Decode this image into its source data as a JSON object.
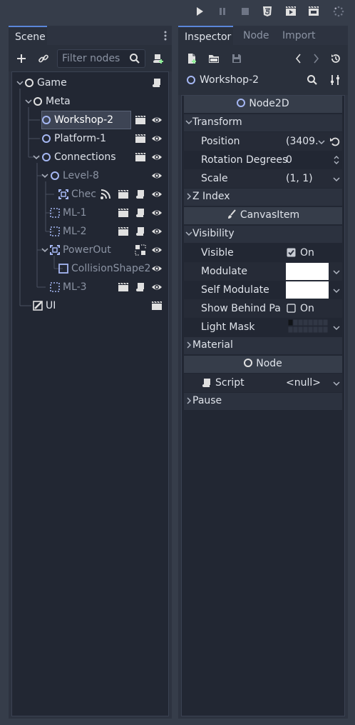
{
  "toolbar": {
    "play": "play-icon",
    "pause": "pause-icon",
    "stop": "stop-icon",
    "html5": "html5-icon",
    "play_scene": "play-scene-icon",
    "play_custom": "play-custom-scene-icon",
    "spinner": "loading-spinner-icon"
  },
  "scene_dock": {
    "tab": "Scene",
    "filter_placeholder": "Filter nodes",
    "tree": [
      {
        "name": "Game",
        "icon": "node-circle-icon",
        "muted": false
      },
      {
        "name": "Meta",
        "icon": "node-circle-icon",
        "muted": false
      },
      {
        "name": "Workshop-2",
        "icon": "node2d-circle-icon",
        "muted": false,
        "selected": true
      },
      {
        "name": "Platform-1",
        "icon": "node2d-circle-icon",
        "muted": false
      },
      {
        "name": "Connections",
        "icon": "node2d-circle-icon",
        "muted": false
      },
      {
        "name": "Level-8",
        "icon": "node2d-circle-icon",
        "muted": true
      },
      {
        "name": "Chec",
        "icon": "area2d-icon",
        "muted": true
      },
      {
        "name": "ML-1",
        "icon": "area-box-icon",
        "muted": true
      },
      {
        "name": "ML-2",
        "icon": "area-box-icon",
        "muted": true
      },
      {
        "name": "PowerOut",
        "icon": "area2d-icon",
        "muted": true
      },
      {
        "name": "CollisionShape2",
        "icon": "collision-shape-icon",
        "muted": true
      },
      {
        "name": "ML-3",
        "icon": "area-box-icon",
        "muted": true
      },
      {
        "name": "UI",
        "icon": "control-icon",
        "muted": false
      }
    ]
  },
  "inspector": {
    "tabs": [
      "Inspector",
      "Node",
      "Import"
    ],
    "object_name": "Workshop-2",
    "sections": {
      "node2d": "Node2D",
      "canvas_item": "CanvasItem",
      "node": "Node"
    },
    "groups": {
      "transform": "Transform",
      "z_index": "Z Index",
      "visibility": "Visibility",
      "material": "Material",
      "pause": "Pause"
    },
    "props": {
      "position_label": "Position",
      "position_value": "(3409.",
      "rotation_label": "Rotation Degrees",
      "rotation_value": "0",
      "scale_label": "Scale",
      "scale_value": "(1, 1)",
      "visible_label": "Visible",
      "visible_value": "On",
      "modulate_label": "Modulate",
      "self_modulate_label": "Self Modulate",
      "show_behind_label": "Show Behind Par",
      "show_behind_value": "On",
      "light_mask_label": "Light Mask",
      "script_label": "Script",
      "script_value": "<null>"
    }
  },
  "colors": {
    "accent": "#5a86d9",
    "node_icon": "#a5b7f3",
    "muted_text": "#8b93a3",
    "text": "#dfe3ea",
    "swatch": "#ffffff"
  }
}
